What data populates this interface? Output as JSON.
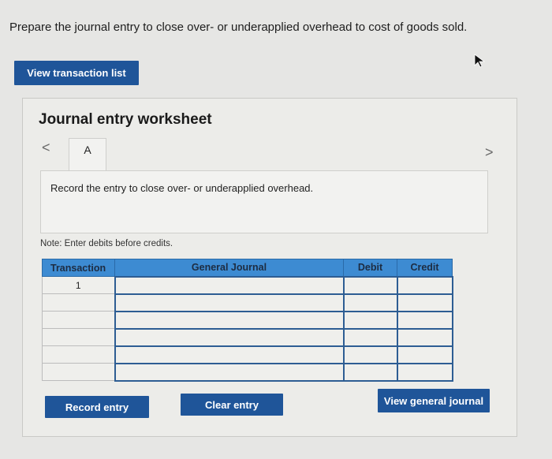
{
  "prompt": "Prepare the journal entry to close over- or underapplied overhead to cost of goods sold.",
  "buttons": {
    "view_transaction_list": "View transaction list",
    "record_entry": "Record entry",
    "clear_entry": "Clear entry",
    "view_general_journal": "View general journal"
  },
  "worksheet": {
    "title": "Journal entry worksheet",
    "prev_arrow": "<",
    "next_arrow": ">",
    "tab_label": "A",
    "instruction": "Record the entry to close over- or underapplied overhead.",
    "note": "Note: Enter debits before credits."
  },
  "table": {
    "headers": [
      "Transaction",
      "General Journal",
      "Debit",
      "Credit"
    ],
    "rows": [
      [
        "1",
        "",
        "",
        ""
      ],
      [
        "",
        "",
        "",
        ""
      ],
      [
        "",
        "",
        "",
        ""
      ],
      [
        "",
        "",
        "",
        ""
      ],
      [
        "",
        "",
        "",
        ""
      ],
      [
        "",
        "",
        "",
        ""
      ]
    ]
  }
}
